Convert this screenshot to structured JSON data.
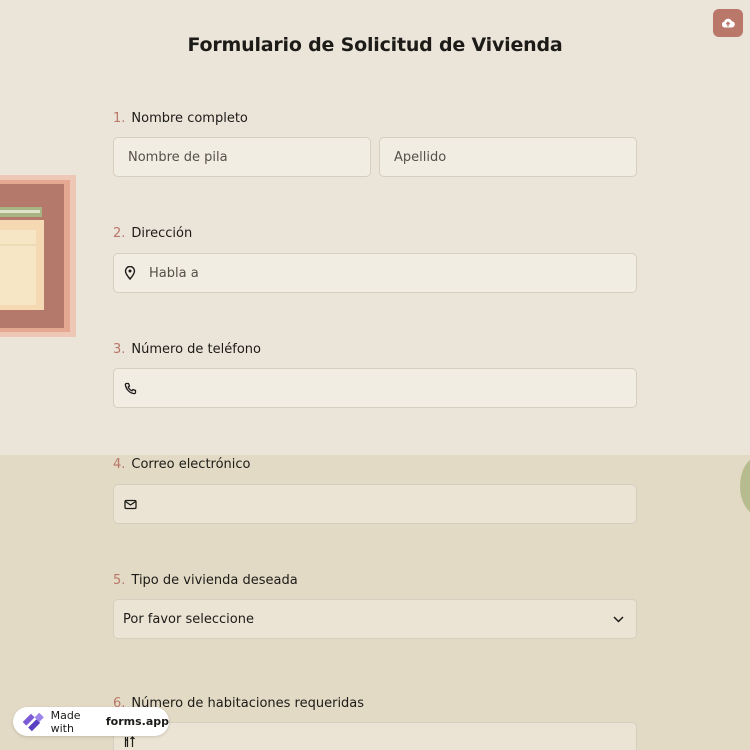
{
  "form": {
    "title": "Formulario de Solicitud de Vivienda"
  },
  "colors": {
    "accent": "#b9786a",
    "background_top": "#ebe4d9",
    "background_bottom": "#e2dac4"
  },
  "upload_icon": "cloud-upload-icon",
  "questions": [
    {
      "number": "1.",
      "label": "Nombre completo",
      "fields": [
        {
          "placeholder": "Nombre de pila"
        },
        {
          "placeholder": "Apellido"
        }
      ]
    },
    {
      "number": "2.",
      "label": "Dirección",
      "icon": "map-pin-icon",
      "placeholder": "Habla a"
    },
    {
      "number": "3.",
      "label": "Número de teléfono",
      "icon": "phone-icon",
      "placeholder": ""
    },
    {
      "number": "4.",
      "label": "Correo electrónico",
      "icon": "envelope-icon",
      "placeholder": ""
    },
    {
      "number": "5.",
      "label": "Tipo de vivienda deseada",
      "selected": "Por favor seleccione",
      "icon": "chevron-down-icon"
    },
    {
      "number": "6.",
      "label": "Número de habitaciones requeridas",
      "icon": "number-icon"
    }
  ],
  "badge": {
    "prefix": "Made with",
    "brand": "forms.app"
  }
}
